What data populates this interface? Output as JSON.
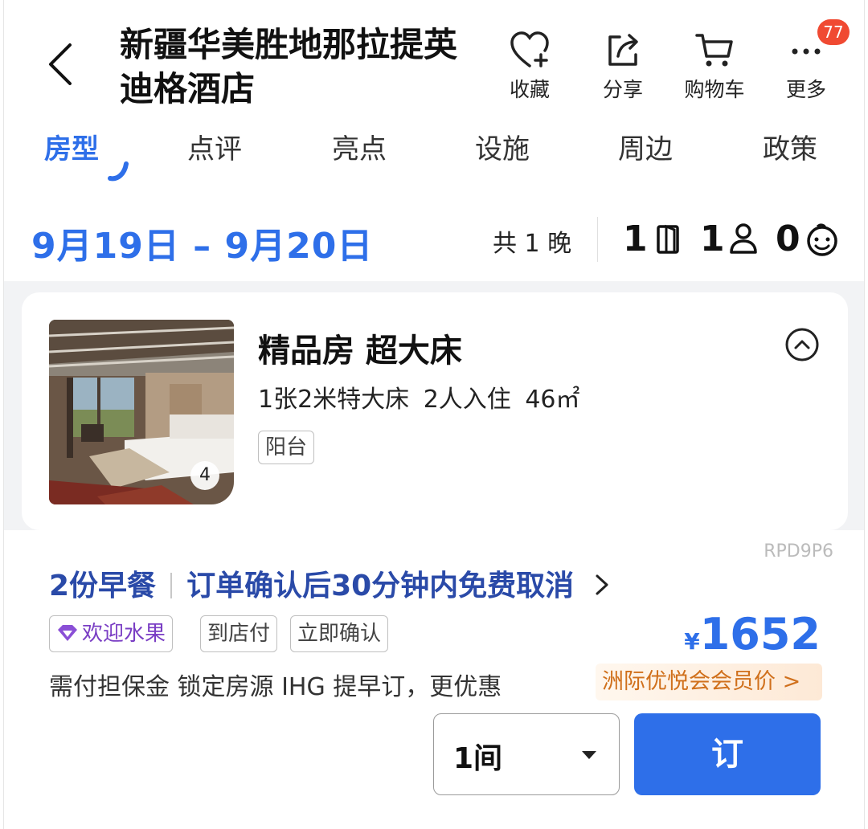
{
  "header": {
    "title": "新疆华美胜地那拉提英迪格酒店",
    "favorite_label": "收藏",
    "share_label": "分享",
    "cart_label": "购物车",
    "more_label": "更多",
    "more_badge": "77"
  },
  "tabs": [
    {
      "label": "房型",
      "active": true
    },
    {
      "label": "点评"
    },
    {
      "label": "亮点"
    },
    {
      "label": "设施"
    },
    {
      "label": "周边"
    },
    {
      "label": "政策"
    }
  ],
  "stay": {
    "date_range": "9月19日 – 9月20日",
    "nights": "共 1 晚",
    "rooms": "1",
    "adults": "1",
    "children": "0"
  },
  "room": {
    "name": "精品房 超大床",
    "spec": "1张2米特大床 2人入住 46㎡",
    "tag": "阳台",
    "photo_count": "4"
  },
  "rate": {
    "code": "RPD9P6",
    "breakfast": "2份早餐",
    "cancel": "订单确认后30分钟内免费取消",
    "tags": [
      "欢迎水果",
      "到店付",
      "立即确认"
    ],
    "currency": "¥",
    "price": "1652",
    "note": "需付担保金 锁定房源 IHG 提早订，更优惠",
    "member_label": "洲际优悦会会员价 >",
    "quantity": "1间",
    "book_label": "订"
  },
  "colors": {
    "accent": "#2e6fe9",
    "rate_title": "#2a4aa8",
    "member": "#d0701c",
    "badge": "#f04a32"
  }
}
